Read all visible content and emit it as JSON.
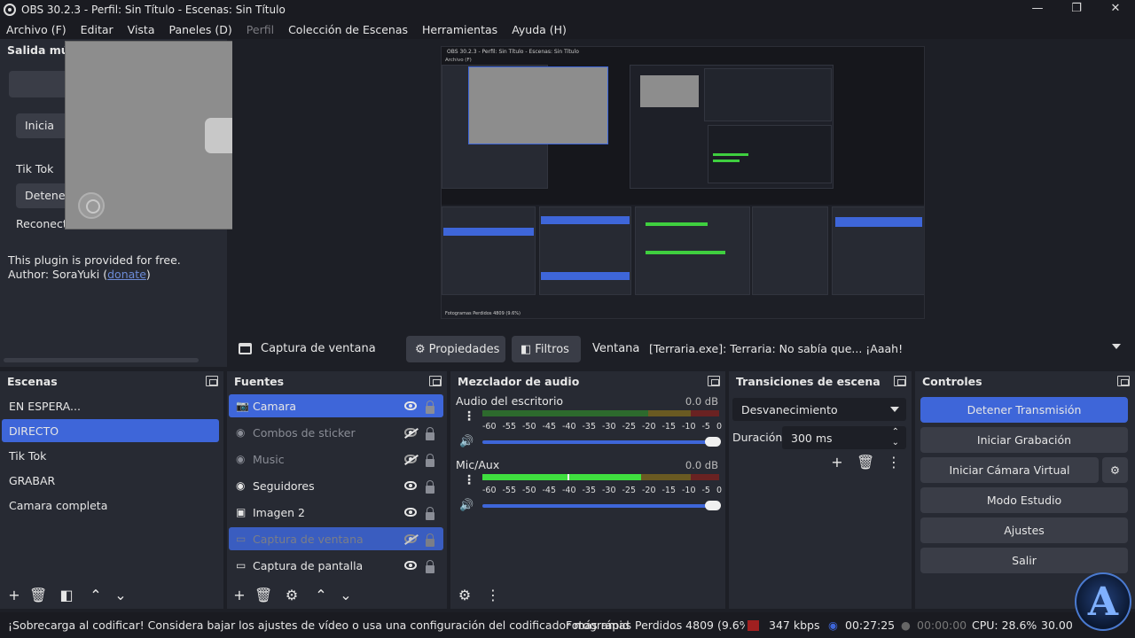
{
  "window": {
    "title": "OBS 30.2.3 - Perfil: Sin Título - Escenas: Sin Título",
    "controls": [
      "—",
      "❐",
      "✕"
    ]
  },
  "menu": [
    "Archivo (F)",
    "Editar",
    "Vista",
    "Paneles (D)",
    "Perfil",
    "Colección de Escenas",
    "Herramientas",
    "Ayuda (H)"
  ],
  "plugin_dock": {
    "title": "Salida múlt",
    "btn_start": "Inicia",
    "platform": "Tik Tok",
    "btn_stop": "Detene",
    "reconnect": "Reconecta",
    "info": "This plugin is provided for free.",
    "author_prefix": "Author: SoraYuki (",
    "author_link": "donate",
    "author_suffix": ")"
  },
  "source_toolbar": {
    "source_name": "Captura de ventana",
    "properties": "Propiedades",
    "filters": "Filtros",
    "window_label": "Ventana",
    "window_value": "[Terraria.exe]: Terraria: No sabía que... ¡Aaah!"
  },
  "scenes": {
    "title": "Escenas",
    "items": [
      "EN ESPERA...",
      "DIRECTO",
      "Tik Tok",
      "GRABAR",
      "Camara completa"
    ],
    "selected": 1
  },
  "sources": {
    "title": "Fuentes",
    "items": [
      {
        "label": "Camara",
        "icon": "camera-icon",
        "visible": true,
        "selected": true
      },
      {
        "label": "Combos de sticker",
        "icon": "globe-icon",
        "visible": false,
        "selected": false
      },
      {
        "label": "Music",
        "icon": "globe-icon",
        "visible": false,
        "selected": false
      },
      {
        "label": "Seguidores",
        "icon": "globe-icon",
        "visible": true,
        "selected": false
      },
      {
        "label": "Imagen 2",
        "icon": "image-icon",
        "visible": true,
        "selected": false
      },
      {
        "label": "Captura de ventana",
        "icon": "window-icon",
        "visible": false,
        "selected": true
      },
      {
        "label": "Captura de pantalla",
        "icon": "monitor-icon",
        "visible": true,
        "selected": false
      }
    ]
  },
  "mixer": {
    "title": "Mezclador de audio",
    "channels": [
      {
        "name": "Audio del escritorio",
        "db": "0.0 dB"
      },
      {
        "name": "Mic/Aux",
        "db": "0.0 dB"
      }
    ],
    "scale": [
      "-60",
      "-55",
      "-50",
      "-45",
      "-40",
      "-35",
      "-30",
      "-25",
      "-20",
      "-15",
      "-10",
      "-5",
      "0"
    ]
  },
  "transitions": {
    "title": "Transiciones de escena",
    "selected": "Desvanecimiento",
    "duration_label": "Duración",
    "duration_value": "300 ms"
  },
  "controls": {
    "title": "Controles",
    "stop_stream": "Detener Transmisión",
    "start_record": "Iniciar Grabación",
    "virtual_cam": "Iniciar Cámara Virtual",
    "studio_mode": "Modo Estudio",
    "settings": "Ajustes",
    "exit": "Salir"
  },
  "status": {
    "warning": "¡Sobrecarga al codificar! Considera bajar los ajustes de vídeo o usa una configuración del codificador más rápid",
    "dropped": "Fotogramas Perdidos 4809 (9.6%)",
    "bitrate": "347 kbps",
    "stream_time": "00:27:25",
    "record_time": "00:00:00",
    "cpu": "CPU: 28.6%",
    "fps": "30.00"
  },
  "logo_letter": "A",
  "colors": {
    "accent": "#3e66d9",
    "panel": "#272a33",
    "bg": "#1d1f26"
  }
}
